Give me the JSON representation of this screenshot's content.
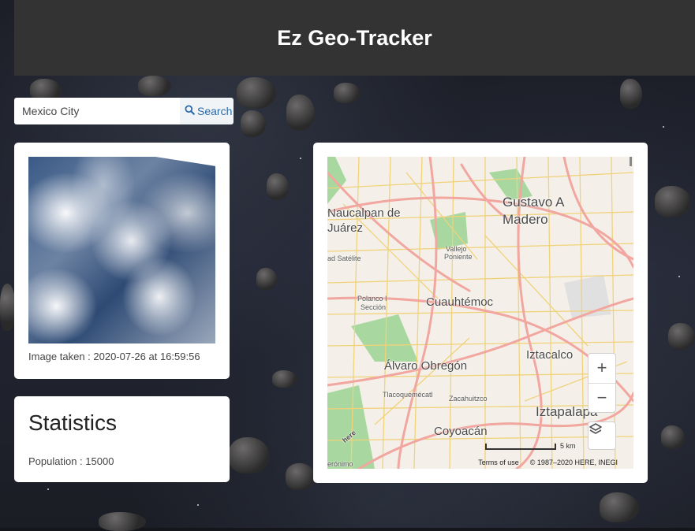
{
  "header": {
    "title": "Ez Geo-Tracker"
  },
  "search": {
    "value": "Mexico City",
    "button_label": "Search"
  },
  "image_card": {
    "caption": "Image taken : 2020-07-26 at 16:59:56"
  },
  "stats_card": {
    "title": "Statistics",
    "population": "Population : 15000"
  },
  "map": {
    "labels": [
      "Gustavo A",
      "Madero",
      "Naucalpan de",
      "Juárez",
      "Vallejo",
      "Poniente",
      "Cuauhtémoc",
      "Polanco I",
      "Sección",
      "Iztacalco",
      "Álvaro Obregón",
      "Tlacoquemécatl",
      "Zacahuitzco",
      "Iztapalapa",
      "Coyoacán",
      "ad Satélite",
      "here",
      "erónimo"
    ],
    "zoom_in": "+",
    "zoom_out": "−",
    "scale_label": "5 km",
    "terms": "Terms of use",
    "copyright": "© 1987–2020 HERE, INEGI"
  },
  "colors": {
    "header_bg": "#333333",
    "search_button_text": "#2a6aa8",
    "map_major_road": "#f2a6a0",
    "map_minor_road": "#f0d27a",
    "map_park": "#a8d8a0"
  }
}
